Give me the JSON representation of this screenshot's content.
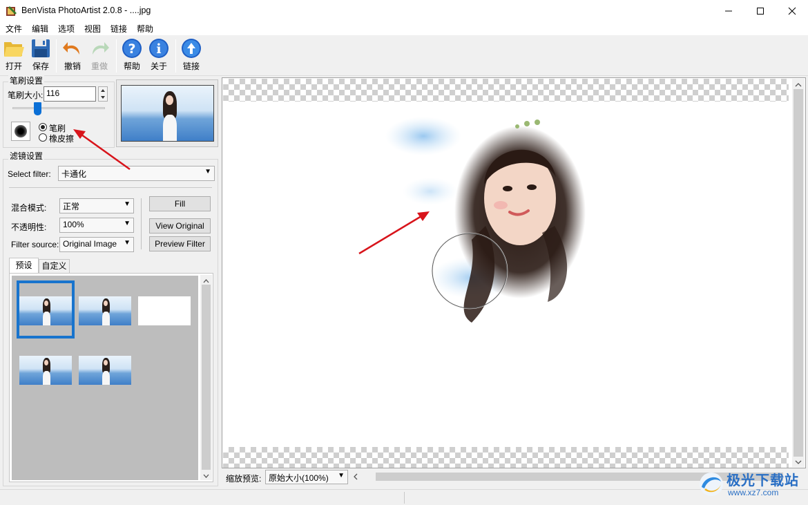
{
  "window": {
    "title": "BenVista PhotoArtist 2.0.8 - ....jpg"
  },
  "menu": [
    "文件",
    "编辑",
    "选项",
    "视图",
    "链接",
    "帮助"
  ],
  "toolbar": {
    "open": "打开",
    "save": "保存",
    "undo": "撤销",
    "redo": "重做",
    "help": "帮助",
    "about": "关于",
    "link": "链接"
  },
  "brush": {
    "group_title": "笔刷设置",
    "size_label": "笔刷大小:",
    "size_value": "116",
    "slider_value": 0.27,
    "mode_brush": "笔刷",
    "mode_eraser": "橡皮擦",
    "selected_mode": "brush"
  },
  "filter": {
    "group_title": "滤镜设置",
    "select_label": "Select filter:",
    "select_value": "卡通化",
    "blend_label": "混合模式:",
    "blend_value": "正常",
    "opacity_label": "不透明性:",
    "opacity_value": "100%",
    "source_label": "Filter source:",
    "source_value": "Original Image",
    "fill_button": "Fill",
    "view_original_button": "View Original",
    "preview_filter_button": "Preview Filter"
  },
  "presets": {
    "tab_preset": "预设",
    "tab_custom": "自定义"
  },
  "zoom": {
    "label": "缩放预览:",
    "value": "原始大小(100%)"
  },
  "watermark": {
    "brand": "极光下载站",
    "url": "www.xz7.com"
  },
  "colors": {
    "accent": "#0a6fd6",
    "arrow": "#d8141b",
    "selection": "#1874cd"
  }
}
